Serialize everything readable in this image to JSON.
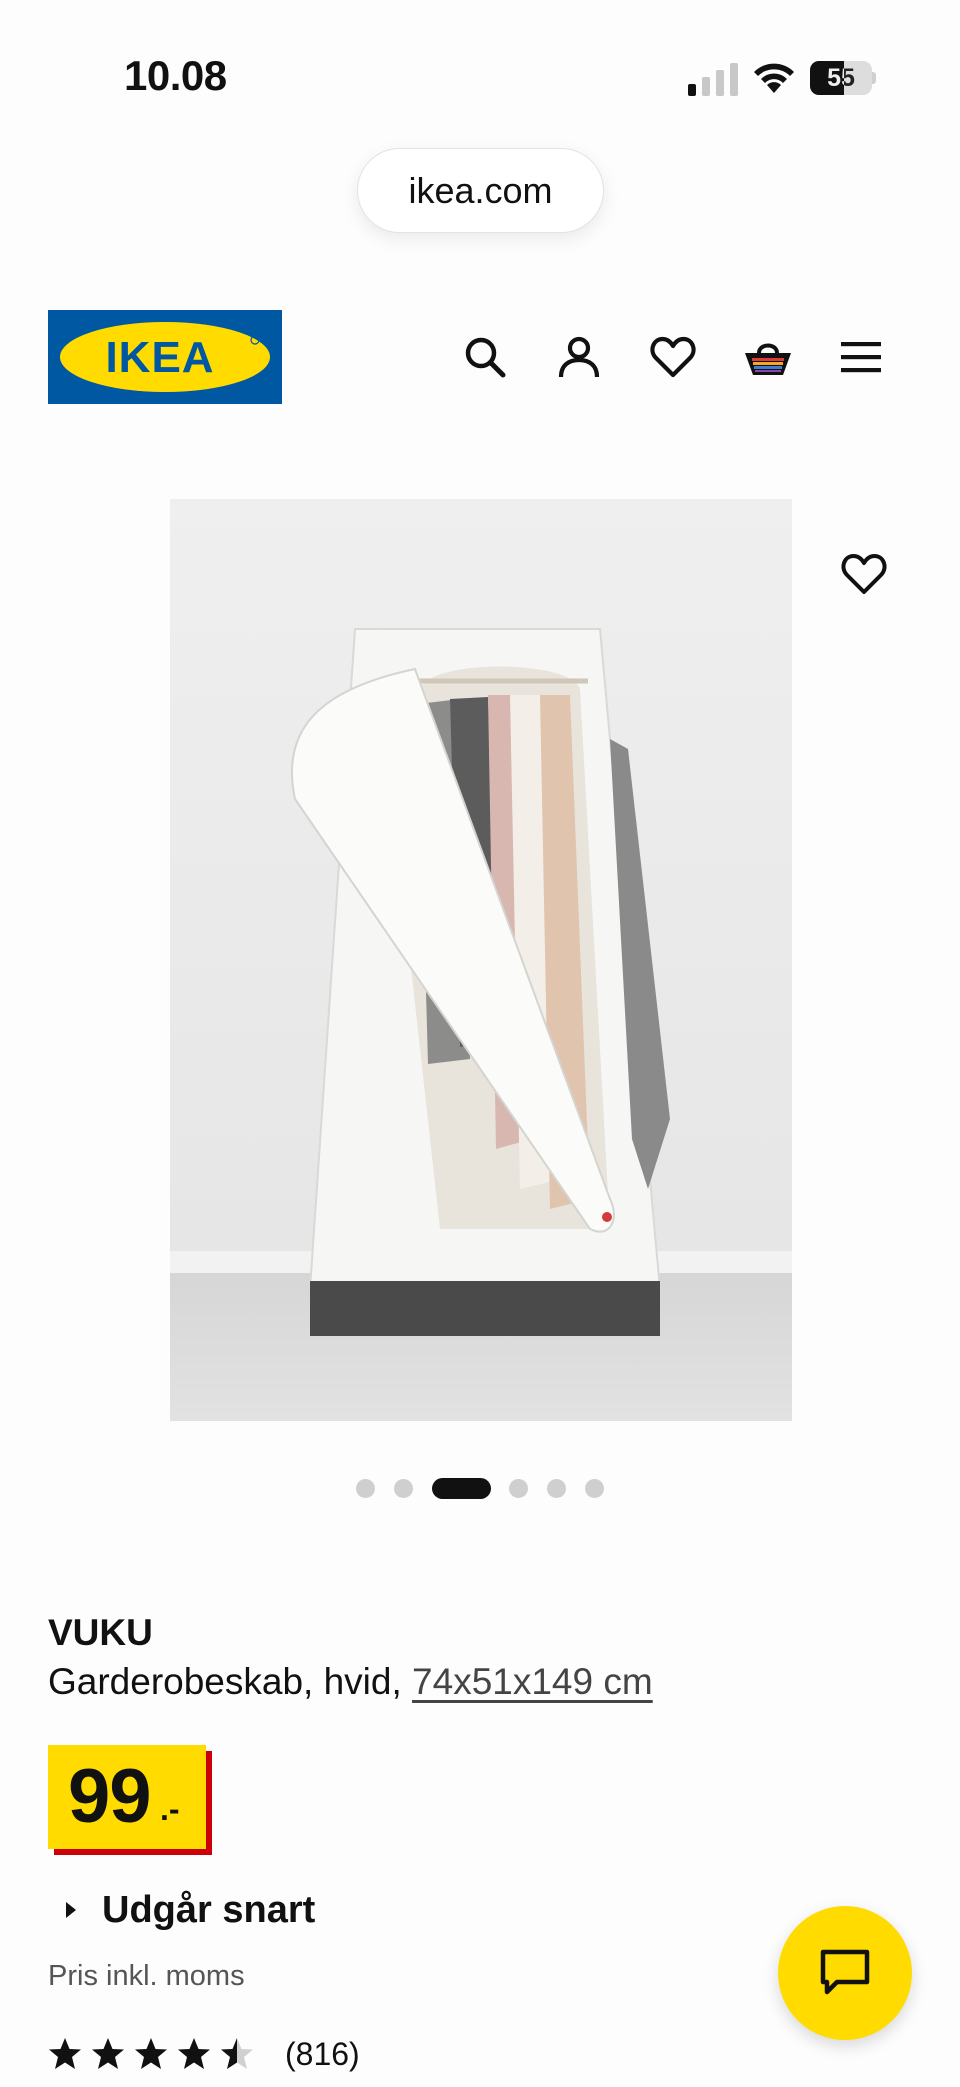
{
  "status_bar": {
    "time": "10.08",
    "battery_level": "55",
    "battery_fraction": 0.55,
    "signal_bars_active": 1,
    "signal_bars_total": 4
  },
  "browser": {
    "url": "ikea.com"
  },
  "header": {
    "logo_text": "IKEA",
    "brand_colors": {
      "blue": "#0058a3",
      "yellow": "#ffdb00"
    },
    "icons": [
      "search-icon",
      "account-icon",
      "wishlist-icon",
      "basket-icon",
      "menu-icon"
    ]
  },
  "gallery": {
    "image_count": 6,
    "active_index": 2,
    "favorite_icon": "heart-icon"
  },
  "product": {
    "name": "VUKU",
    "description_prefix": "Garderobeskab, hvid, ",
    "dimensions": "74x51x149 cm",
    "price_integer": "99",
    "price_suffix": ".-",
    "price_colors": {
      "tag": "#ffdb00",
      "accent": "#cc0008"
    },
    "status_label": "Udgår snart",
    "vat_note": "Pris inkl. moms",
    "rating_value": 4.5,
    "rating_max": 5,
    "review_count": "(816)"
  },
  "chat": {
    "icon": "chat-icon"
  }
}
